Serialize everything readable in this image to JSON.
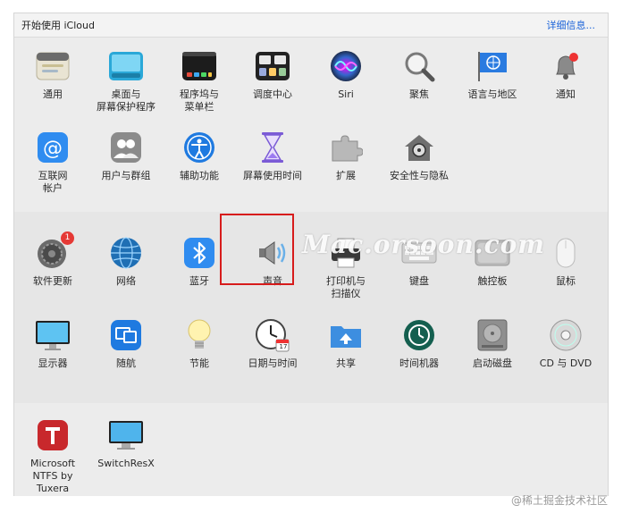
{
  "header": {
    "title": "开始使用 iCloud",
    "details_link": "详细信息..."
  },
  "prefs_row1": [
    "通用",
    "桌面与\n屏幕保护程序",
    "程序坞与\n菜单栏",
    "调度中心",
    "Siri",
    "聚焦",
    "语言与地区",
    "通知"
  ],
  "prefs_row2": [
    "互联网\n帐户",
    "用户与群组",
    "辅助功能",
    "屏幕使用时间",
    "扩展",
    "安全性与隐私"
  ],
  "prefs_row3": [
    "软件更新",
    "网络",
    "蓝牙",
    "声音",
    "打印机与\n扫描仪",
    "键盘",
    "触控板",
    "鼠标"
  ],
  "prefs_row4": [
    "显示器",
    "随航",
    "节能",
    "日期与时间",
    "共享",
    "时间机器",
    "启动磁盘",
    "CD 与 DVD"
  ],
  "prefs_row5": [
    "Microsoft\nNTFS by Tuxera",
    "SwitchResX"
  ],
  "badges": {
    "software_update": "1"
  },
  "calendar_day": "17",
  "watermark": "Mac.orsoon.com",
  "credit": "@稀土掘金技术社区",
  "colors": {
    "highlight": "#d71c1c",
    "link": "#1b63d9"
  }
}
